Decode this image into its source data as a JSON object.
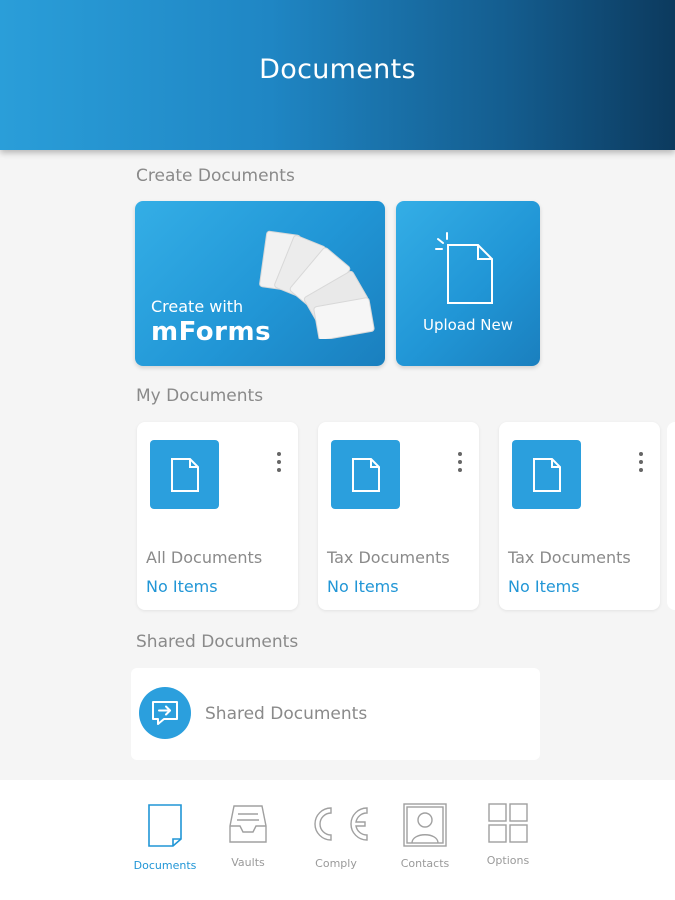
{
  "header": {
    "title": "Documents"
  },
  "create_section": {
    "label": "Create Documents",
    "mforms_tile": {
      "line1": "Create with",
      "line2": "mForms",
      "icon": "stacked-papers-icon"
    },
    "upload_tile": {
      "label": "Upload New",
      "icon": "new-document-icon"
    }
  },
  "my_documents": {
    "label": "My Documents",
    "cards": [
      {
        "name": "All Documents",
        "count": "No Items",
        "icon": "document-icon"
      },
      {
        "name": "Tax Documents",
        "count": "No Items",
        "icon": "document-icon"
      },
      {
        "name": "Tax Documents",
        "count": "No Items",
        "icon": "document-icon"
      }
    ]
  },
  "shared_section": {
    "label": "Shared Documents",
    "row_label": "Shared Documents",
    "icon": "shared-message-icon"
  },
  "bottom_nav": {
    "items": [
      {
        "label": "Documents",
        "icon": "document-icon",
        "active": true
      },
      {
        "label": "Vaults",
        "icon": "inbox-tray-icon",
        "active": false
      },
      {
        "label": "Comply",
        "icon": "ce-mark-icon",
        "active": false
      },
      {
        "label": "Contacts",
        "icon": "contact-card-icon",
        "active": false
      },
      {
        "label": "Options",
        "icon": "grid-icon",
        "active": false
      }
    ]
  },
  "colors": {
    "accent": "#2196d6",
    "header_dark": "#0c3a5e",
    "muted_text": "#8a8a8a"
  }
}
